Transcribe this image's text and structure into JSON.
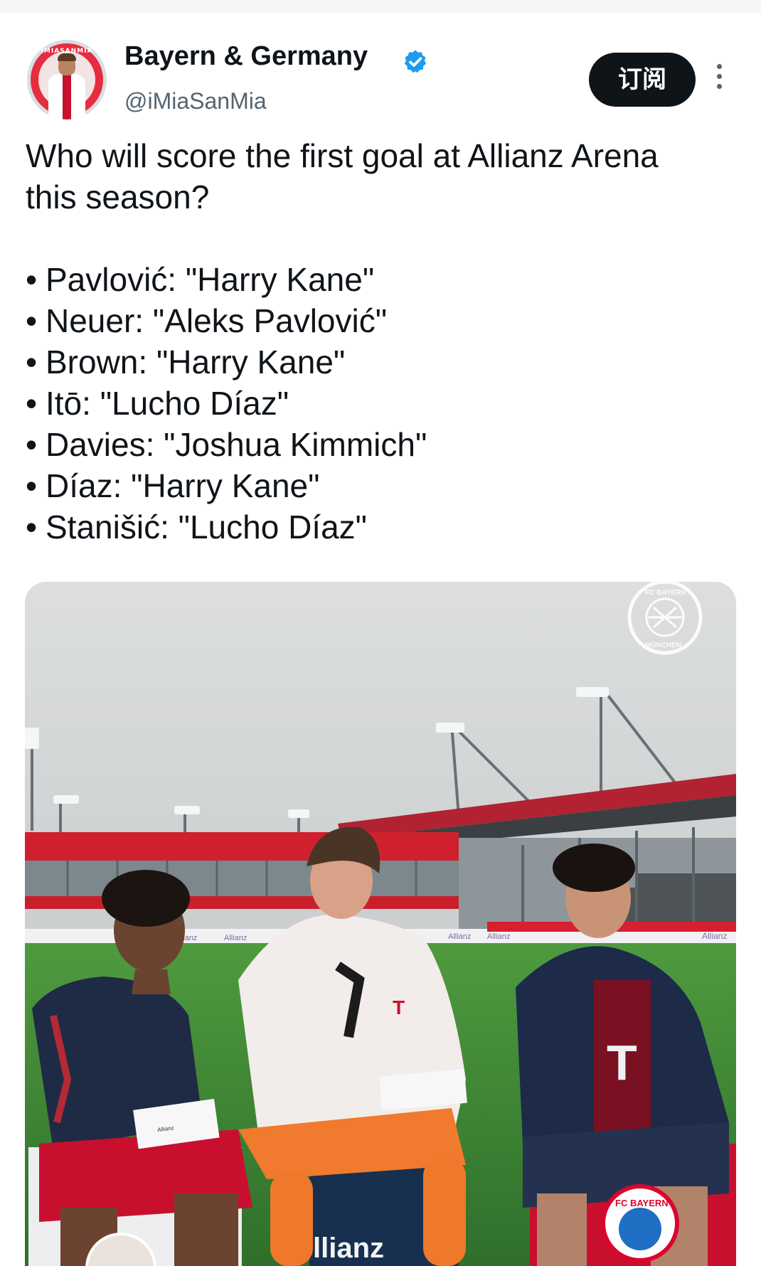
{
  "account": {
    "display_name": "Bayern & Germany",
    "handle": "@iMiaSanMia",
    "verified": true,
    "avatar_ring_text": "IMIASANMIA",
    "subscribe_label": "订阅"
  },
  "tweet": {
    "question_line1": "Who will score the first goal at Allianz Arena",
    "question_line2": "this season?",
    "predictions": [
      {
        "bullet": "•",
        "text": "Pavlović: \"Harry Kane\""
      },
      {
        "bullet": "•",
        "text": "Neuer: \"Aleks Pavlović\""
      },
      {
        "bullet": "•",
        "text": "Brown: \"Harry Kane\""
      },
      {
        "bullet": "•",
        "text": "Itō: \"Lucho Díaz\""
      },
      {
        "bullet": "•",
        "text": "Davies: \"Joshua Kimmich\""
      },
      {
        "bullet": "•",
        "text": "Díaz: \"Harry Kane\""
      },
      {
        "bullet": "•",
        "text": "Stanišić: \"Lucho Díaz\""
      }
    ]
  },
  "media": {
    "watermark_top": "FC BAYERN",
    "watermark_bottom": "MÜNCHEN",
    "board_label_1": "Allianz",
    "board_label_2": "Allianz",
    "board_label_3": "Allianz",
    "board_label_4": "Allianz",
    "board_label_5": "Allianz",
    "board_label_6": "Al",
    "seat_label": "llianz",
    "jersey_logo": "T",
    "crest_text": "FC BAYERN",
    "sheet_label": "Allianz"
  },
  "colors": {
    "text_primary": "#0f1419",
    "text_secondary": "#536471",
    "verified_blue": "#1d9bf0",
    "bayern_red": "#dc052d"
  },
  "icons": {
    "verified": "verified-badge-icon",
    "more": "more-vertical-icon"
  }
}
